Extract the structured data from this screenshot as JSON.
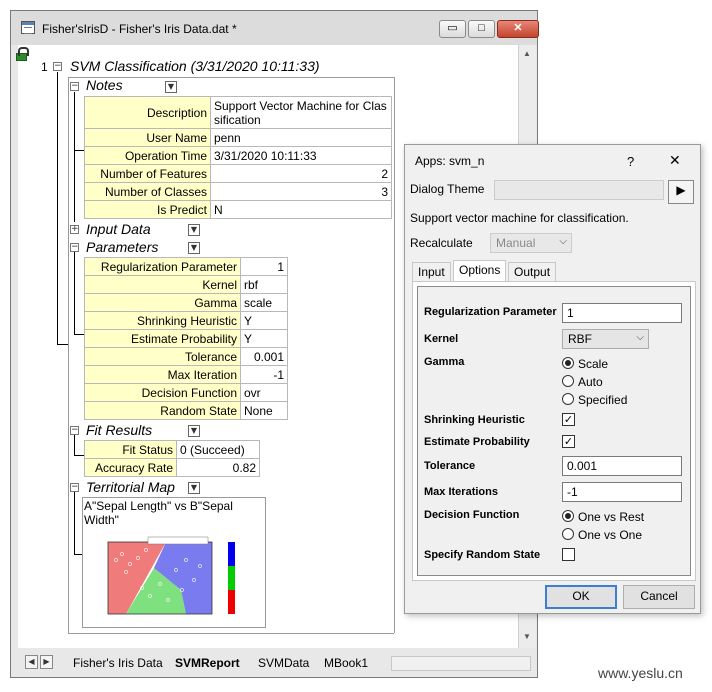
{
  "window": {
    "title": "Fisher'sIrisD - Fisher's Iris Data.dat *",
    "minimize_glyph": "▭",
    "restore_glyph": "□",
    "close_glyph": "✕"
  },
  "report": {
    "row_number": "1",
    "title": "SVM Classification (3/31/2020 10:11:33)",
    "notes": {
      "label": "Notes",
      "rows": [
        {
          "key": "Description",
          "value": "Support Vector Machine for Classification"
        },
        {
          "key": "User Name",
          "value": "penn"
        },
        {
          "key": "Operation Time",
          "value": "3/31/2020 10:11:33"
        },
        {
          "key": "Number of Features",
          "value": "2"
        },
        {
          "key": "Number of Classes",
          "value": "3"
        },
        {
          "key": "Is Predict",
          "value": "N"
        }
      ]
    },
    "input_data": {
      "label": "Input Data"
    },
    "parameters": {
      "label": "Parameters",
      "rows": [
        {
          "key": "Regularization Parameter",
          "value": "1"
        },
        {
          "key": "Kernel",
          "value": "rbf"
        },
        {
          "key": "Gamma",
          "value": "scale"
        },
        {
          "key": "Shrinking Heuristic",
          "value": "Y"
        },
        {
          "key": "Estimate Probability",
          "value": "Y"
        },
        {
          "key": "Tolerance",
          "value": "0.001"
        },
        {
          "key": "Max Iteration",
          "value": "-1"
        },
        {
          "key": "Decision Function",
          "value": "ovr"
        },
        {
          "key": "Random State",
          "value": "None"
        }
      ]
    },
    "fit_results": {
      "label": "Fit Results",
      "rows": [
        {
          "key": "Fit Status",
          "value": "0 (Succeed)"
        },
        {
          "key": "Accuracy Rate",
          "value": "0.82"
        }
      ]
    },
    "territorial_map": {
      "label": "Territorial Map",
      "caption": "A\"Sepal Length\" vs B\"Sepal Width\""
    }
  },
  "sheet_tabs": [
    "Fisher's Iris Data",
    "SVMReport",
    "SVMData",
    "MBook1"
  ],
  "active_sheet_tab": "SVMReport",
  "dialog": {
    "title": "Apps: svm_n",
    "help_glyph": "?",
    "close_glyph": "✕",
    "theme_label": "Dialog Theme",
    "theme_value": "",
    "theme_arrow": "▶",
    "description": "Support vector machine for classification.",
    "recalculate_label": "Recalculate",
    "recalculate_value": "Manual",
    "tabs": [
      "Input",
      "Options",
      "Output"
    ],
    "active_tab": "Options",
    "options": {
      "regularization_label": "Regularization Parameter",
      "regularization_value": "1",
      "kernel_label": "Kernel",
      "kernel_value": "RBF",
      "gamma_label": "Gamma",
      "gamma_options": [
        "Scale",
        "Auto",
        "Specified"
      ],
      "gamma_selected": "Scale",
      "shrinking_label": "Shrinking Heuristic",
      "shrinking_checked": true,
      "estimate_label": "Estimate Probability",
      "estimate_checked": true,
      "tolerance_label": "Tolerance",
      "tolerance_value": "0.001",
      "max_iter_label": "Max Iterations",
      "max_iter_value": "-1",
      "decision_label": "Decision Function",
      "decision_options": [
        "One vs Rest",
        "One vs One"
      ],
      "decision_selected": "One vs Rest",
      "random_state_label": "Specify Random State",
      "random_state_checked": false
    },
    "ok_label": "OK",
    "cancel_label": "Cancel"
  },
  "watermark": "www.yeslu.cn",
  "colors": {
    "accent": "#3c7fd0",
    "table_key_bg": "#ffffc8",
    "region_red": "#f07b7b",
    "region_green": "#7fe07f",
    "region_blue": "#7b7bf0"
  }
}
